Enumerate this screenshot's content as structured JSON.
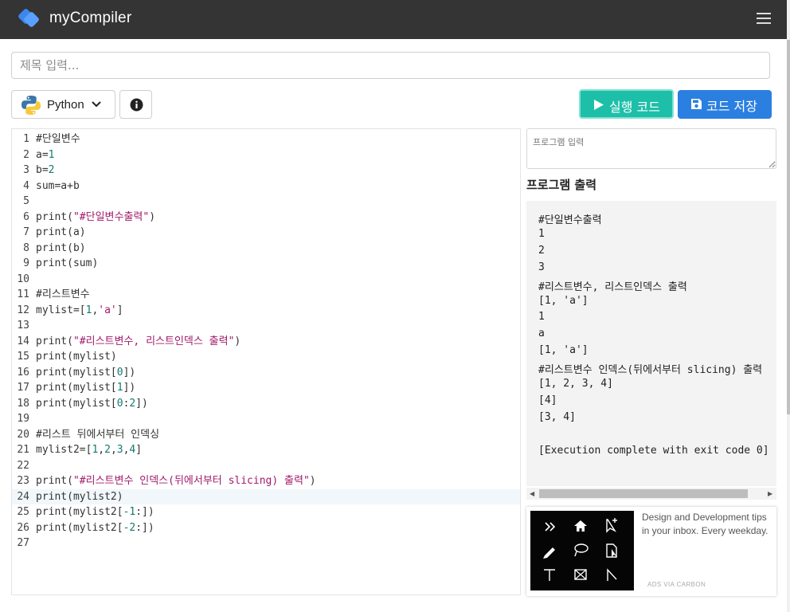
{
  "app": {
    "brand": "myCompiler",
    "accent": "#2b7fe0"
  },
  "title_input": {
    "placeholder": "제목 입력...",
    "value": ""
  },
  "toolbar": {
    "language": "Python",
    "run_label": "실행 코드",
    "save_label": "코드 저장"
  },
  "editor": {
    "active_line": 24,
    "lines": [
      {
        "n": "1",
        "tokens": [
          {
            "t": "#단일변수",
            "c": "plain"
          }
        ]
      },
      {
        "n": "2",
        "tokens": [
          {
            "t": "a=",
            "c": "plain"
          },
          {
            "t": "1",
            "c": "num"
          }
        ]
      },
      {
        "n": "3",
        "tokens": [
          {
            "t": "b=",
            "c": "plain"
          },
          {
            "t": "2",
            "c": "num"
          }
        ]
      },
      {
        "n": "4",
        "tokens": [
          {
            "t": "sum=a+b",
            "c": "plain"
          }
        ]
      },
      {
        "n": "5",
        "tokens": []
      },
      {
        "n": "6",
        "tokens": [
          {
            "t": "print(",
            "c": "plain"
          },
          {
            "t": "\"#단일변수출력\"",
            "c": "str"
          },
          {
            "t": ")",
            "c": "plain"
          }
        ]
      },
      {
        "n": "7",
        "tokens": [
          {
            "t": "print(a)",
            "c": "plain"
          }
        ]
      },
      {
        "n": "8",
        "tokens": [
          {
            "t": "print(b)",
            "c": "plain"
          }
        ]
      },
      {
        "n": "9",
        "tokens": [
          {
            "t": "print(sum)",
            "c": "plain"
          }
        ]
      },
      {
        "n": "10",
        "tokens": []
      },
      {
        "n": "11",
        "tokens": [
          {
            "t": "#리스트변수",
            "c": "plain"
          }
        ]
      },
      {
        "n": "12",
        "tokens": [
          {
            "t": "mylist=[",
            "c": "plain"
          },
          {
            "t": "1",
            "c": "num"
          },
          {
            "t": ",",
            "c": "plain"
          },
          {
            "t": "'a'",
            "c": "str"
          },
          {
            "t": "]",
            "c": "plain"
          }
        ]
      },
      {
        "n": "13",
        "tokens": []
      },
      {
        "n": "14",
        "tokens": [
          {
            "t": "print(",
            "c": "plain"
          },
          {
            "t": "\"#리스트변수, 리스트인덱스 출력\"",
            "c": "str"
          },
          {
            "t": ")",
            "c": "plain"
          }
        ]
      },
      {
        "n": "15",
        "tokens": [
          {
            "t": "print(mylist)",
            "c": "plain"
          }
        ]
      },
      {
        "n": "16",
        "tokens": [
          {
            "t": "print(mylist[",
            "c": "plain"
          },
          {
            "t": "0",
            "c": "num"
          },
          {
            "t": "])",
            "c": "plain"
          }
        ]
      },
      {
        "n": "17",
        "tokens": [
          {
            "t": "print(mylist[",
            "c": "plain"
          },
          {
            "t": "1",
            "c": "num"
          },
          {
            "t": "])",
            "c": "plain"
          }
        ]
      },
      {
        "n": "18",
        "tokens": [
          {
            "t": "print(mylist[",
            "c": "plain"
          },
          {
            "t": "0",
            "c": "num"
          },
          {
            "t": ":",
            "c": "plain"
          },
          {
            "t": "2",
            "c": "num"
          },
          {
            "t": "])",
            "c": "plain"
          }
        ]
      },
      {
        "n": "19",
        "tokens": []
      },
      {
        "n": "20",
        "tokens": [
          {
            "t": "#리스트 뒤에서부터 인덱싱",
            "c": "plain"
          }
        ]
      },
      {
        "n": "21",
        "tokens": [
          {
            "t": "mylist2=[",
            "c": "plain"
          },
          {
            "t": "1",
            "c": "num"
          },
          {
            "t": ",",
            "c": "plain"
          },
          {
            "t": "2",
            "c": "num"
          },
          {
            "t": ",",
            "c": "plain"
          },
          {
            "t": "3",
            "c": "num"
          },
          {
            "t": ",",
            "c": "plain"
          },
          {
            "t": "4",
            "c": "num"
          },
          {
            "t": "]",
            "c": "plain"
          }
        ]
      },
      {
        "n": "22",
        "tokens": []
      },
      {
        "n": "23",
        "tokens": [
          {
            "t": "print(",
            "c": "plain"
          },
          {
            "t": "\"#리스트변수 인덱스(뒤에서부터 slicing) 출력\"",
            "c": "str"
          },
          {
            "t": ")",
            "c": "plain"
          }
        ]
      },
      {
        "n": "24",
        "tokens": [
          {
            "t": "print(mylist2)",
            "c": "plain"
          }
        ]
      },
      {
        "n": "25",
        "tokens": [
          {
            "t": "print(mylist2[",
            "c": "plain"
          },
          {
            "t": "-1",
            "c": "num"
          },
          {
            "t": ":])",
            "c": "plain"
          }
        ]
      },
      {
        "n": "26",
        "tokens": [
          {
            "t": "print(mylist2[",
            "c": "plain"
          },
          {
            "t": "-2",
            "c": "num"
          },
          {
            "t": ":])",
            "c": "plain"
          }
        ]
      },
      {
        "n": "27",
        "tokens": []
      }
    ]
  },
  "stdin": {
    "placeholder": "프로그램 입력"
  },
  "output": {
    "heading": "프로그램 출력",
    "lines": [
      "#단일변수출력",
      "1",
      "2",
      "3",
      "#리스트변수, 리스트인덱스 출력",
      "[1, 'a']",
      "1",
      "a",
      "[1, 'a']",
      "#리스트변수 인덱스(뒤에서부터 slicing) 출력",
      "[1, 2, 3, 4]",
      "[4]",
      "[3, 4]",
      "",
      "[Execution complete with exit code 0]"
    ]
  },
  "ad": {
    "text": "Design and Development tips in your inbox. Every weekday.",
    "via": "ADS VIA CARBON"
  }
}
